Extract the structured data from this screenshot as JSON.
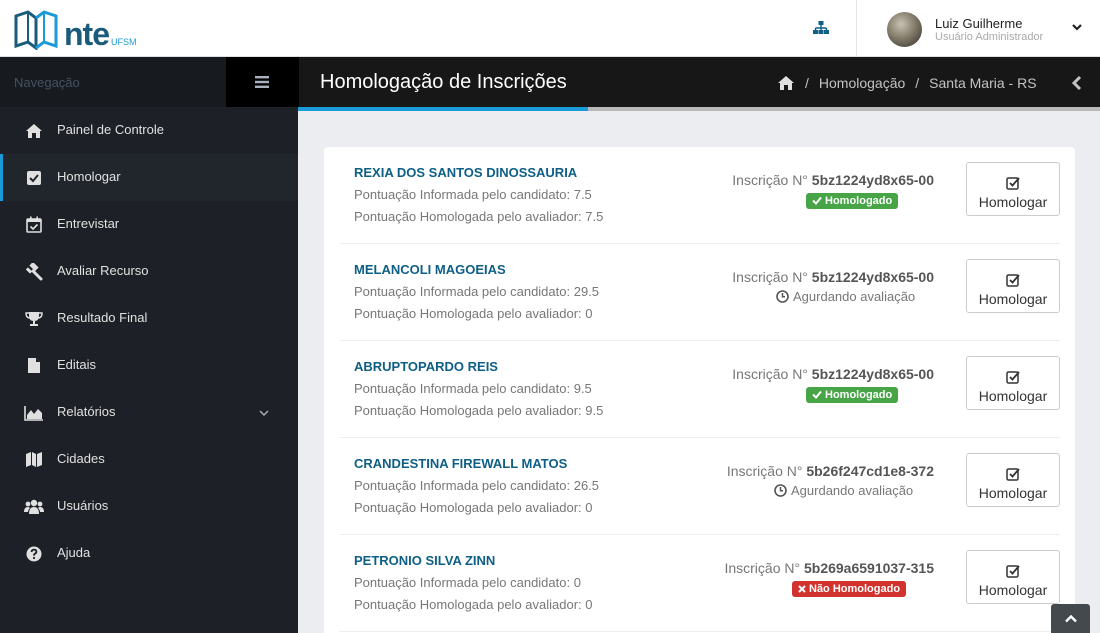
{
  "header": {
    "logo_text": "nte",
    "logo_sub": "UFSM",
    "user_name": "Luiz Guilherme",
    "user_role": "Usuário Administrador"
  },
  "sidebar": {
    "label": "Navegação",
    "items": [
      {
        "label": "Painel de Controle",
        "icon": "home-icon"
      },
      {
        "label": "Homologar",
        "icon": "check-square-icon",
        "active": true
      },
      {
        "label": "Entrevistar",
        "icon": "calendar-check-icon"
      },
      {
        "label": "Avaliar Recurso",
        "icon": "gavel-icon"
      },
      {
        "label": "Resultado Final",
        "icon": "trophy-icon"
      },
      {
        "label": "Editais",
        "icon": "file-icon"
      },
      {
        "label": "Relatórios",
        "icon": "area-chart-icon",
        "has_children": true
      },
      {
        "label": "Cidades",
        "icon": "map-icon"
      },
      {
        "label": "Usuários",
        "icon": "users-icon"
      },
      {
        "label": "Ajuda",
        "icon": "question-circle-icon"
      }
    ]
  },
  "page": {
    "title": "Homologação de Inscrições",
    "breadcrumbs": [
      "Homologação",
      "Santa Maria - RS"
    ]
  },
  "candidates": [
    {
      "name": "REXIA DOS SANTOS DINOSSAURIA",
      "informed": "Pontuação Informada pelo candidato: 7.5",
      "homologated": "Pontuação Homologada pelo avaliador: 7.5",
      "insc_prefix": "Inscrição N°",
      "insc_code": "5bz1224yd8x65-00",
      "status": "Homologado",
      "status_type": "ok",
      "button": "Homologar"
    },
    {
      "name": "MELANCOLI MAGOEIAS",
      "informed": "Pontuação Informada pelo candidato: 29.5",
      "homologated": "Pontuação Homologada pelo avaliador: 0",
      "insc_prefix": "Inscrição N°",
      "insc_code": "5bz1224yd8x65-00",
      "status": "Agurdando avaliação",
      "status_type": "waiting",
      "button": "Homologar"
    },
    {
      "name": "ABRUPTOPARDO REIS",
      "informed": "Pontuação Informada pelo candidato: 9.5",
      "homologated": "Pontuação Homologada pelo avaliador: 9.5",
      "insc_prefix": "Inscrição N°",
      "insc_code": "5bz1224yd8x65-00",
      "status": "Homologado",
      "status_type": "ok",
      "button": "Homologar"
    },
    {
      "name": "CRANDESTINA FIREWALL MATOS",
      "informed": "Pontuação Informada pelo candidato: 26.5",
      "homologated": "Pontuação Homologada pelo avaliador: 0",
      "insc_prefix": "Inscrição N°",
      "insc_code": "5b26f247cd1e8-372",
      "status": "Agurdando avaliação",
      "status_type": "waiting",
      "button": "Homologar"
    },
    {
      "name": "PETRONIO SILVA ZINN",
      "informed": "Pontuação Informada pelo candidato: 0",
      "homologated": "Pontuação Homologada pelo avaliador: 0",
      "insc_prefix": "Inscrição N°",
      "insc_code": "5b269a6591037-315",
      "status": "Não Homologado",
      "status_type": "bad",
      "button": "Homologar"
    }
  ],
  "colors": {
    "accent": "#1a9ad6",
    "link": "#0e5f86",
    "success": "#47a447",
    "danger": "#d2322d"
  }
}
